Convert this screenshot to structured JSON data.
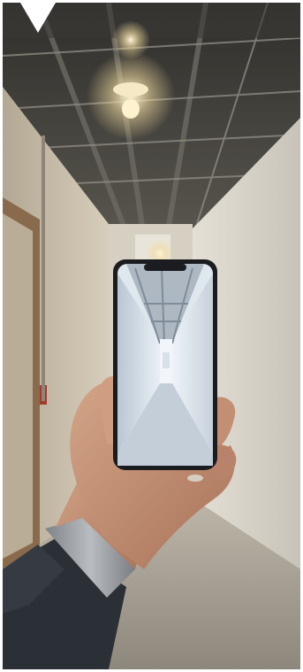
{
  "image": {
    "subject": "hand-holding-smartphone-in-corridor",
    "colors": {
      "ceiling": "#3e3c38",
      "left_wall": "#c9bfae",
      "right_wall": "#dcd7cd",
      "floor": "#9e968a",
      "door_frame": "#8a6a4c",
      "phone_body": "#1b1c1f",
      "phone_screen_wall": "#e8eef4",
      "phone_screen_floor": "#c9d3dd",
      "skin": "#c79778",
      "sleeve": "#2b2f36",
      "watch_band": "#9b9fa3",
      "ceiling_light": "#fff1c4"
    },
    "icons": {
      "corner_marker": "triangle-down-icon"
    }
  }
}
